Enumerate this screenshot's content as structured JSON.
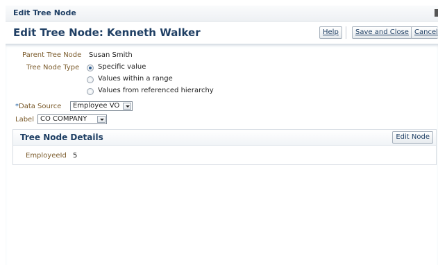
{
  "window": {
    "title": "Edit Tree Node"
  },
  "header": {
    "page_title": "Edit Tree Node: Kenneth Walker",
    "help_label": "Help",
    "save_close_label": "Save and Close",
    "cancel_label": "Cancel"
  },
  "form": {
    "parent_label": "Parent Tree Node",
    "parent_value": "Susan Smith",
    "type_label": "Tree Node Type",
    "type_options": [
      "Specific value",
      "Values within a range",
      "Values from referenced hierarchy"
    ],
    "type_selected": "Specific value",
    "required_mark": "*",
    "datasource_label": "Data Source",
    "datasource_value": "Employee VO",
    "label_label": "Label",
    "label_value": "CO COMPANY"
  },
  "details": {
    "title": "Tree Node Details",
    "edit_button": "Edit Node",
    "field_label": "EmployeeId",
    "field_value": "5"
  }
}
